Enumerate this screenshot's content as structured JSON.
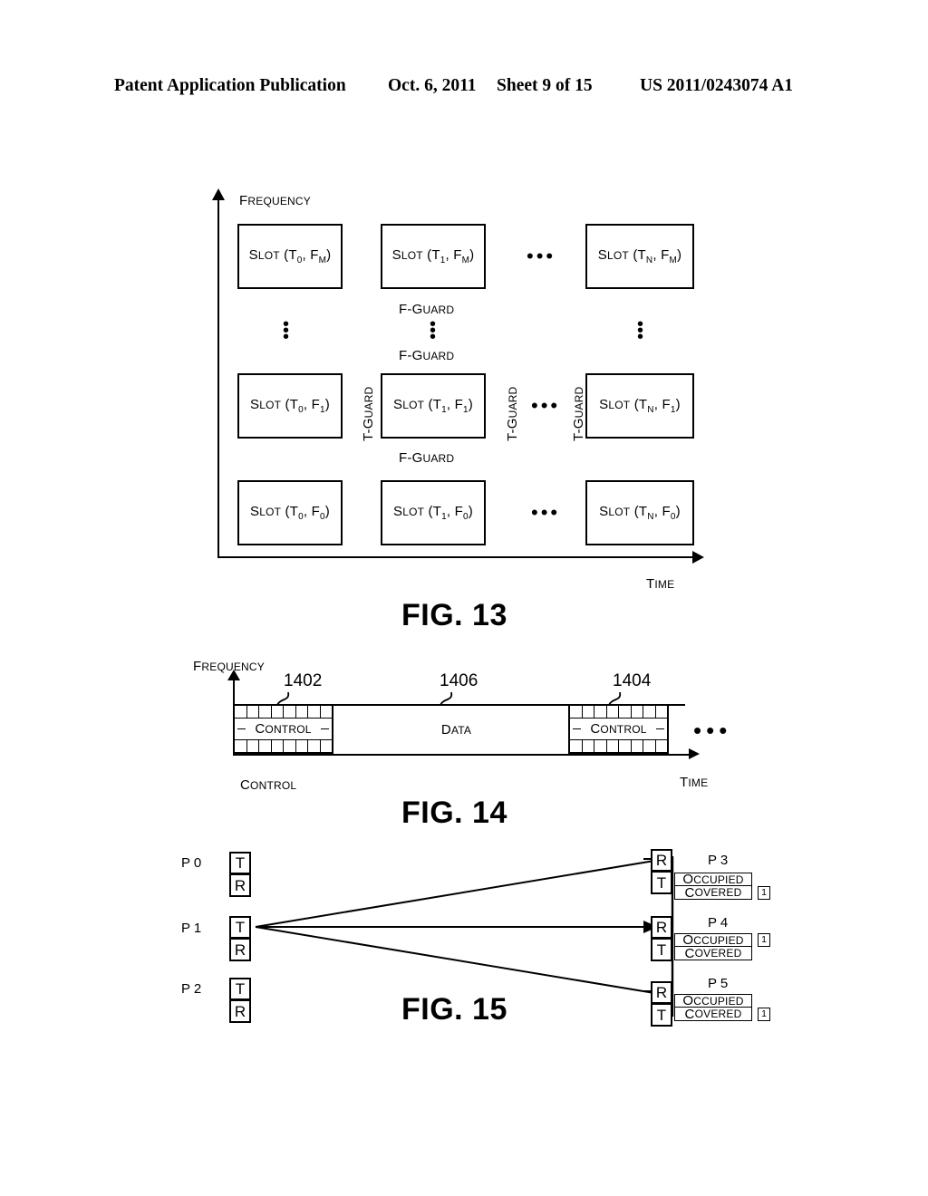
{
  "header": {
    "publication": "Patent Application Publication",
    "date": "Oct. 6, 2011",
    "sheet": "Sheet 9 of 15",
    "patent_number": "US 2011/0243074 A1"
  },
  "fig13": {
    "caption": "FIG. 13",
    "y_axis_label": "Frequency",
    "x_axis_label": "Time",
    "slots": {
      "r2c0": "Slot (T0, FM)",
      "r2c1": "Slot (T1, FM)",
      "r2c2": "Slot (TN, FM)",
      "r1c0": "Slot (T0, F1)",
      "r1c1": "Slot (T1, F1)",
      "r1c2": "Slot (TN, F1)",
      "r0c0": "Slot (T0, F0)",
      "r0c1": "Slot (T1, F0)",
      "r0c2": "Slot (TN, F0)"
    },
    "f_guard_label": "f-Guard",
    "t_guard_label": "t-Guard",
    "f_guard_count": 3,
    "t_guard_count": 3,
    "h_ellipsis": "•••",
    "v_ellipsis": "⋮"
  },
  "fig14": {
    "caption": "FIG. 14",
    "y_axis_label": "Frequency",
    "x_axis_label": "Time",
    "bottom_label": "Control",
    "blocks": [
      {
        "label": "Control",
        "ref": "1402"
      },
      {
        "label": "Data",
        "ref": "1406"
      },
      {
        "label": "Control",
        "ref": "1404"
      }
    ],
    "grid_cells_per_row": 8,
    "trailing_ellipsis": "•••"
  },
  "fig15": {
    "caption": "FIG. 15",
    "left_nodes": [
      {
        "label": "P 0",
        "top": "T",
        "bottom": "R"
      },
      {
        "label": "P 1",
        "top": "T",
        "bottom": "R"
      },
      {
        "label": "P 2",
        "top": "T",
        "bottom": "R"
      }
    ],
    "right_nodes": [
      {
        "label": "P 3",
        "top": "R",
        "bottom": "T",
        "status": [
          {
            "text": "Occupied",
            "flag": ""
          },
          {
            "text": "Covered",
            "flag": "1"
          }
        ]
      },
      {
        "label": "P 4",
        "top": "R",
        "bottom": "T",
        "status": [
          {
            "text": "Occupied",
            "flag": "1"
          },
          {
            "text": "Covered",
            "flag": ""
          }
        ]
      },
      {
        "label": "P 5",
        "top": "R",
        "bottom": "T",
        "status": [
          {
            "text": "Occupied",
            "flag": ""
          },
          {
            "text": "Covered",
            "flag": "1"
          }
        ]
      }
    ]
  },
  "colors": {
    "ink": "#000000",
    "paper": "#ffffff"
  }
}
